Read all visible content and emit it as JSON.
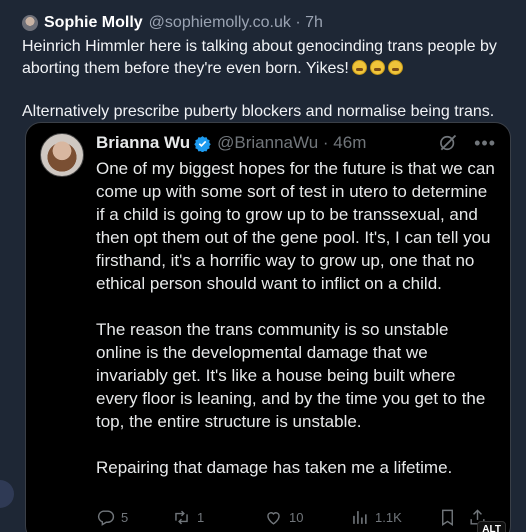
{
  "post": {
    "author": "Sophie Molly",
    "handle": "@sophiemolly.co.uk",
    "time": "7h",
    "text_line1": "Heinrich Himmler here is talking about genocinding trans people by aborting them before they're even born. Yikes!",
    "emoji_icon": "grimacing-face-emoji",
    "text_line2": "Alternatively prescribe puberty blockers and normalise being trans."
  },
  "quote": {
    "author": "Brianna Wu",
    "handle": "@BriannaWu",
    "time": "46m",
    "paragraph1": "One of my biggest hopes for the future is that we can come up with some sort of test in utero to determine if a child is going to grow up to be transsexual, and then opt them out of the gene pool. It's, I can tell you firsthand, it's a horrific way to grow up, one that no ethical person should want to inflict on a child.",
    "paragraph2": "The reason the trans community is so unstable online is the developmental damage that we invariably get. It's like a house being built where every floor is leaning, and by the time you get to the top, the entire structure is unstable.",
    "paragraph3": "Repairing that damage has taken me a lifetime.",
    "replies": "5",
    "reposts": "1",
    "likes": "10",
    "views": "1.1K",
    "alt_badge": "ALT"
  }
}
